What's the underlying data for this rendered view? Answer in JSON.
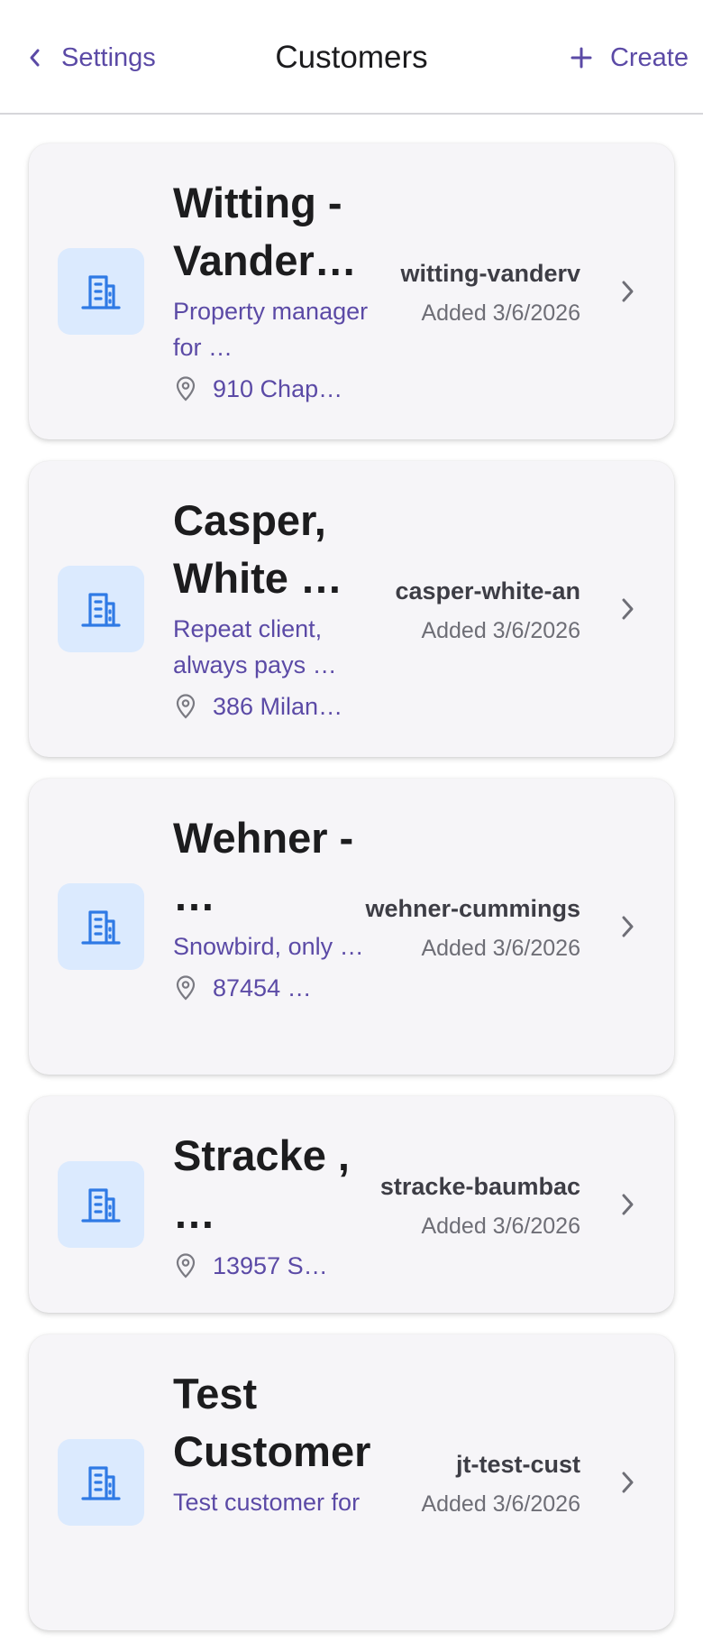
{
  "header": {
    "back_label": "Settings",
    "title": "Customers",
    "create_label": "Create"
  },
  "colors": {
    "accent": "#5b4aa6",
    "avatar_bg": "#dbeafe",
    "avatar_icon": "#2f7ae5",
    "card_bg": "#f6f5f8"
  },
  "icons": {
    "back": "chevron-left-icon",
    "create": "plus-icon",
    "avatar": "building-icon",
    "address": "map-pin-icon",
    "row": "chevron-right-icon"
  },
  "customers": [
    {
      "name": "Witting - Vander…",
      "description": "Property manager for …",
      "address": "910 Chap…",
      "slug": "witting-vanderv",
      "added": "Added 3/6/2026"
    },
    {
      "name": "Casper, White …",
      "description": "Repeat client, always pays …",
      "address": "386 Milan…",
      "slug": "casper-white-an",
      "added": "Added 3/6/2026"
    },
    {
      "name": "Wehner - …",
      "description": "Snowbird, only …",
      "address": "87454 …",
      "slug": "wehner-cummings",
      "added": "Added 3/6/2026"
    },
    {
      "name": "Stracke , …",
      "description": "",
      "address": "13957 S…",
      "slug": "stracke-baumbac",
      "added": "Added 3/6/2026"
    },
    {
      "name": "Test Customer",
      "description": "Test customer for",
      "address": "",
      "slug": "jt-test-cust",
      "added": "Added 3/6/2026"
    }
  ]
}
